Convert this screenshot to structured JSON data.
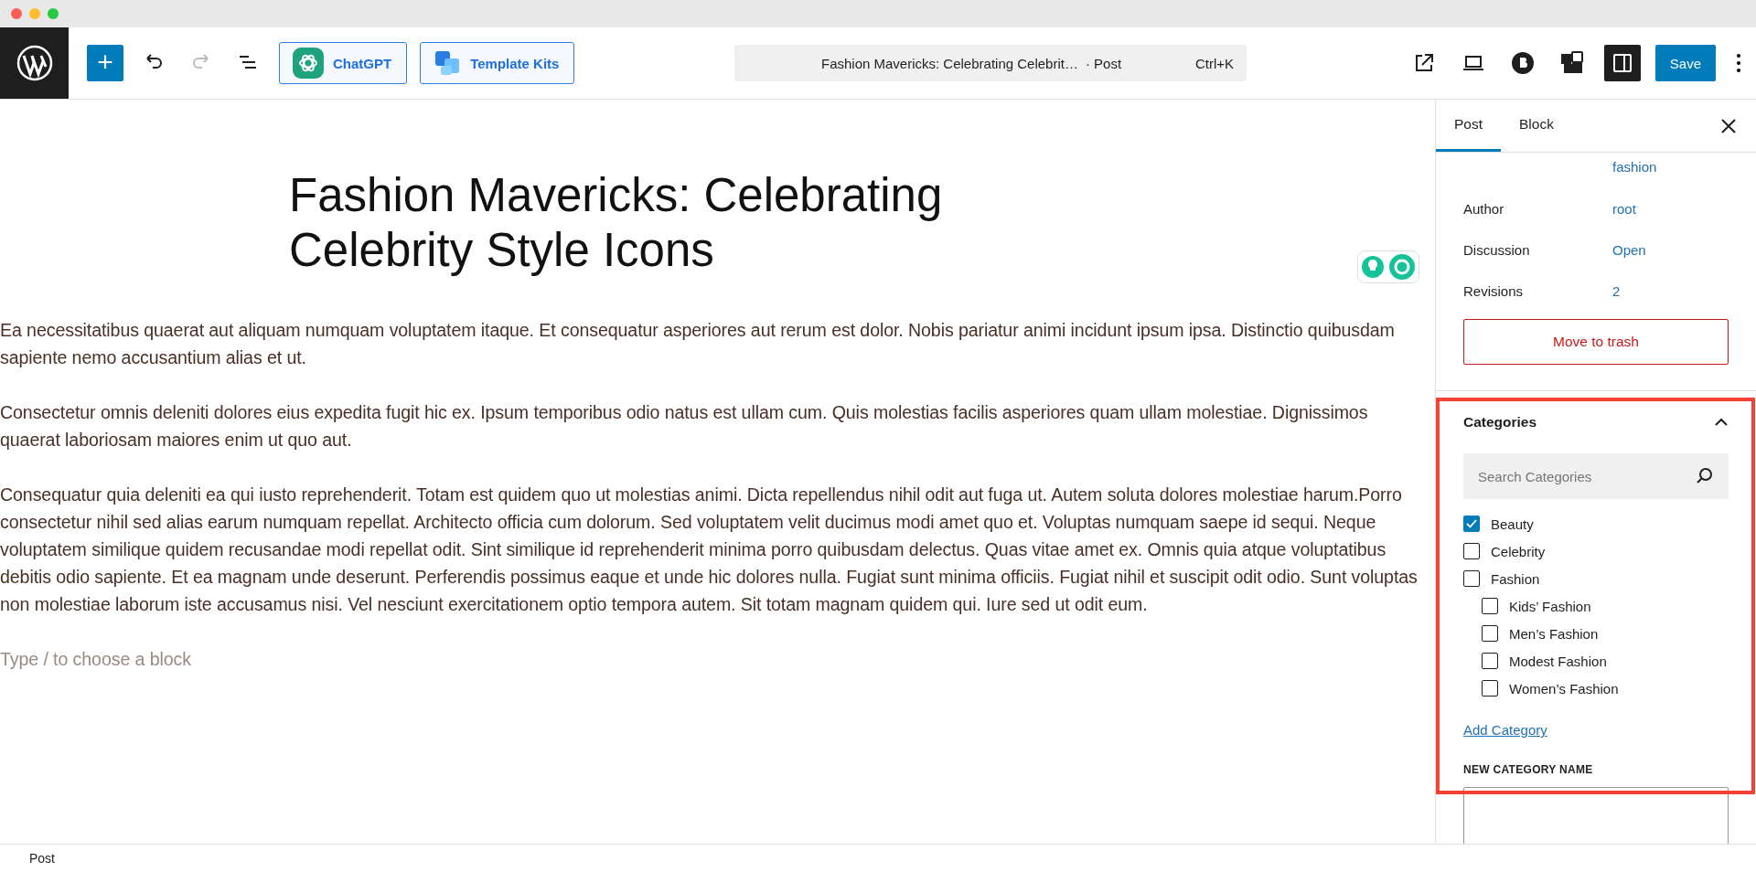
{
  "toolbar": {
    "buttons": [
      {
        "kind": "add",
        "label": "+"
      },
      {
        "kind": "undo"
      },
      {
        "kind": "redo",
        "disabled": true
      },
      {
        "kind": "list"
      }
    ],
    "plugins": [
      {
        "kind": "chatgpt",
        "label": "ChatGPT"
      },
      {
        "kind": "kits",
        "label": "Template Kits"
      }
    ],
    "command": {
      "title": "Fashion Mavericks: Celebrating Celebrit…",
      "type": "· Post",
      "shortcut": "Ctrl+K"
    },
    "actions": [
      {
        "kind": "external"
      },
      {
        "kind": "device"
      },
      {
        "kind": "bcircle"
      },
      {
        "kind": "blocks"
      },
      {
        "kind": "sidebar",
        "selected": true
      }
    ],
    "save": "Save"
  },
  "editor": {
    "title": "Fashion Mavericks: Celebrating Celebrity Style Icons",
    "paragraphs": [
      "Ea necessitatibus quaerat aut aliquam numquam voluptatem itaque. Et consequatur asperiores aut rerum est dolor. Nobis pariatur animi incidunt ipsum ipsa. Distinctio quibusdam sapiente nemo accusantium alias et ut.",
      "Consectetur omnis deleniti dolores eius expedita fugit hic ex. Ipsum temporibus odio natus est ullam cum. Quis molestias facilis asperiores quam ullam molestiae. Dignissimos quaerat laboriosam maiores enim ut quo aut.",
      "Consequatur quia deleniti ea qui iusto reprehenderit. Totam est quidem quo ut molestias animi. Dicta repellendus nihil odit aut fuga ut. Autem soluta dolores molestiae harum.Porro consectetur nihil sed alias earum numquam repellat. Architecto officia cum dolorum. Sed voluptatem velit ducimus modi amet quo et. Voluptas numquam saepe id sequi. Neque voluptatem similique quidem recusandae modi repellat odit. Sint similique id reprehenderit minima porro quibusdam delectus. Quas vitae amet ex. Omnis quia atque voluptatibus debitis odio sapiente. Et ea magnam unde deserunt. Perferendis possimus eaque et unde hic dolores nulla. Fugiat sunt minima officiis. Fugiat nihil et suscipit odit odio. Sunt voluptas non molestiae laborum iste accusamus nisi. Vel nesciunt exercitationem optio tempora autem. Sit totam magnam quidem qui. Iure sed ut odit eum."
    ],
    "placeholder": "Type / to choose a block"
  },
  "sidebar": {
    "tabs": [
      {
        "label": "Post",
        "selected": true
      },
      {
        "label": "Block",
        "selected": false
      }
    ],
    "summary_tail": "fashion",
    "fields": [
      {
        "label": "Author",
        "value": "root"
      },
      {
        "label": "Discussion",
        "value": "Open"
      },
      {
        "label": "Revisions",
        "value": "2"
      }
    ],
    "trash": "Move to trash",
    "categories": {
      "title": "Categories",
      "expanded": true,
      "search_placeholder": "Search Categories",
      "items": [
        {
          "label": "Beauty",
          "checked": true
        },
        {
          "label": "Celebrity",
          "checked": false
        },
        {
          "label": "Fashion",
          "checked": false,
          "children": [
            {
              "label": "Kids’ Fashion",
              "checked": false
            },
            {
              "label": "Men’s Fashion",
              "checked": false
            },
            {
              "label": "Modest Fashion",
              "checked": false
            },
            {
              "label": "Women’s Fashion",
              "checked": false
            }
          ]
        }
      ],
      "add_link": "Add Category",
      "new_label": "NEW CATEGORY NAME"
    }
  },
  "status_bar": "Post"
}
